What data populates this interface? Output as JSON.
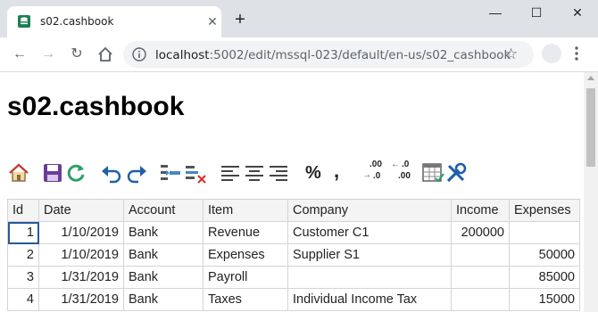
{
  "browser": {
    "tab_title": "s02.cashbook",
    "new_tab_symbol": "+",
    "url_host": "localhost",
    "url_rest": ":5002/edit/mssql-023/default/en-us/s02_cashbook"
  },
  "page": {
    "title": "s02.cashbook"
  },
  "toolbar_icons": [
    "home-icon",
    "save-icon",
    "refresh-icon",
    "undo-icon",
    "redo-icon",
    "insert-row-icon",
    "delete-row-icon",
    "align-left-icon",
    "align-center-icon",
    "align-right-icon",
    "percent-icon",
    "comma-icon",
    "decrease-decimal-icon",
    "increase-decimal-icon",
    "table-format-icon",
    "tools-icon"
  ],
  "toolbar_text": {
    "percent": "%",
    "comma": ",",
    "dec_top": ".00",
    "dec_bottom": ".0",
    "inc_top": ".0",
    "inc_bottom": ".00"
  },
  "table": {
    "columns": [
      "Id",
      "Date",
      "Account",
      "Item",
      "Company",
      "Income",
      "Expenses"
    ],
    "rows": [
      [
        "1",
        "1/10/2019",
        "Bank",
        "Revenue",
        "Customer C1",
        "200000",
        ""
      ],
      [
        "2",
        "1/10/2019",
        "Bank",
        "Expenses",
        "Supplier S1",
        "",
        "50000"
      ],
      [
        "3",
        "1/31/2019",
        "Bank",
        "Payroll",
        "",
        "",
        "85000"
      ],
      [
        "4",
        "1/31/2019",
        "Bank",
        "Taxes",
        "Individual Income Tax",
        "",
        "15000"
      ]
    ]
  },
  "colors": {
    "accent": "#1f5fa8",
    "save": "#6a3d9a",
    "refresh": "#2e9e6a",
    "delete": "#d9302c"
  }
}
